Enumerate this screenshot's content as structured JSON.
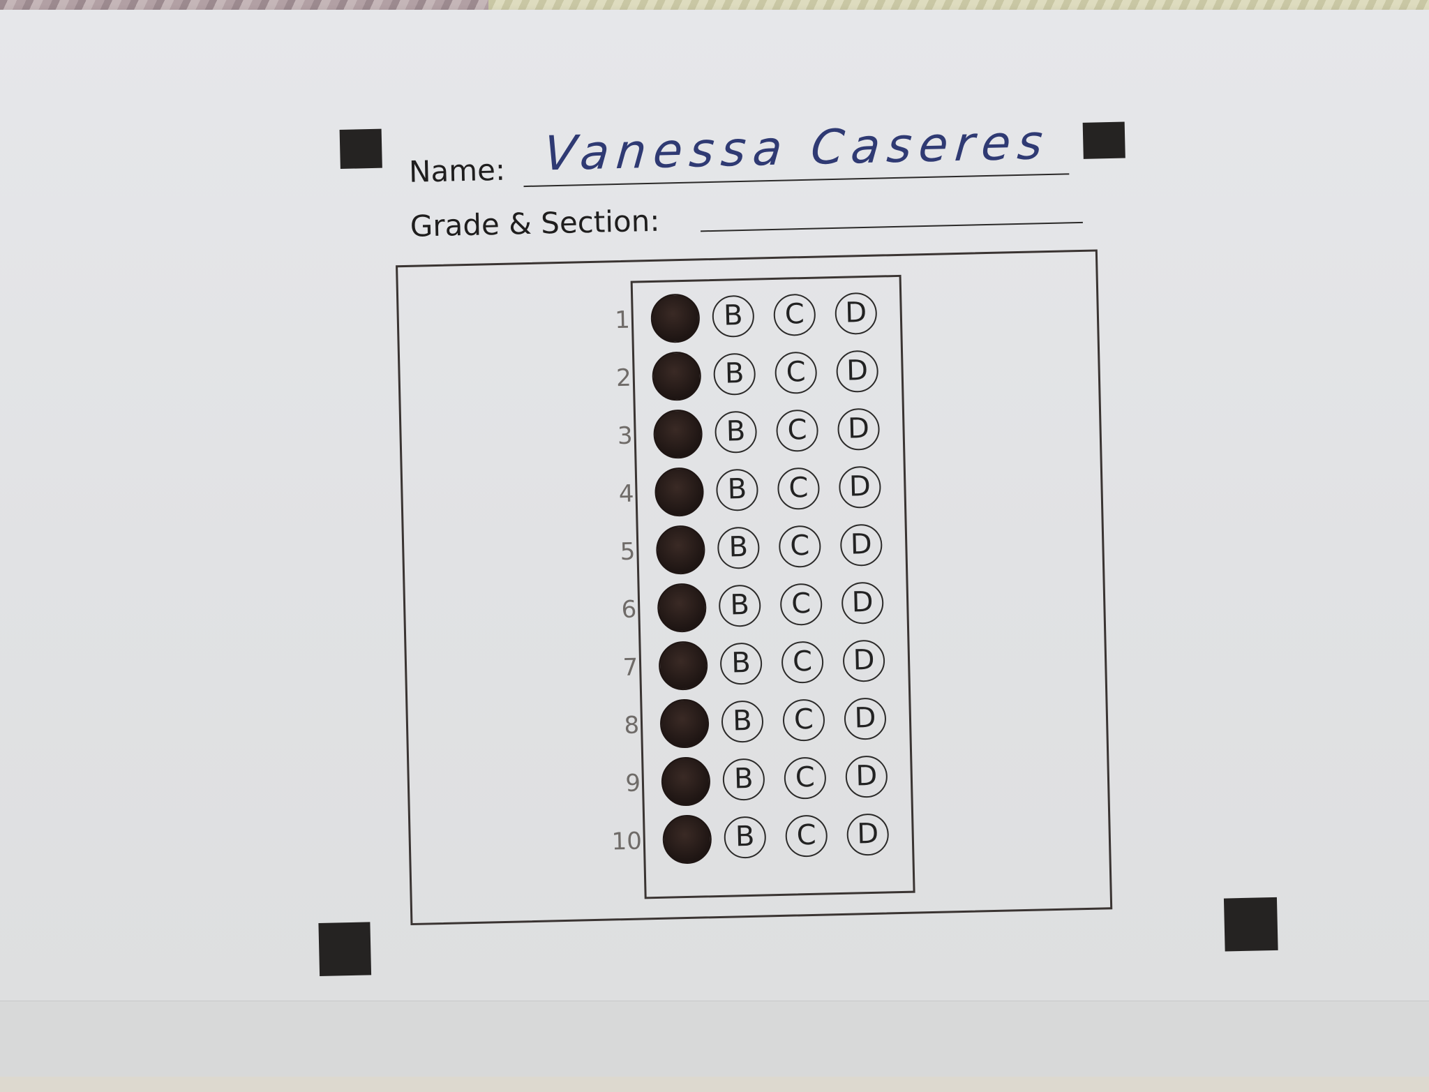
{
  "form": {
    "name_label": "Name:",
    "name_value": "Vanessa Caseres",
    "grade_label": "Grade & Section:",
    "grade_value": ""
  },
  "answer_sheet": {
    "rows": [
      {
        "number": "1",
        "choices": [
          "A",
          "B",
          "C",
          "D"
        ],
        "filled": "A"
      },
      {
        "number": "2",
        "choices": [
          "A",
          "B",
          "C",
          "D"
        ],
        "filled": "A"
      },
      {
        "number": "3",
        "choices": [
          "A",
          "B",
          "C",
          "D"
        ],
        "filled": "A"
      },
      {
        "number": "4",
        "choices": [
          "A",
          "B",
          "C",
          "D"
        ],
        "filled": "A"
      },
      {
        "number": "5",
        "choices": [
          "A",
          "B",
          "C",
          "D"
        ],
        "filled": "A"
      },
      {
        "number": "6",
        "choices": [
          "A",
          "B",
          "C",
          "D"
        ],
        "filled": "A"
      },
      {
        "number": "7",
        "choices": [
          "A",
          "B",
          "C",
          "D"
        ],
        "filled": "A"
      },
      {
        "number": "8",
        "choices": [
          "A",
          "B",
          "C",
          "D"
        ],
        "filled": "A"
      },
      {
        "number": "9",
        "choices": [
          "A",
          "B",
          "C",
          "D"
        ],
        "filled": "A"
      },
      {
        "number": "10",
        "choices": [
          "A",
          "B",
          "C",
          "D"
        ],
        "filled": "A"
      }
    ]
  },
  "colors": {
    "paper": "#e4e5e7",
    "ink": "#1e1513",
    "handwriting": "#2f3a73",
    "marker": "#252322"
  }
}
